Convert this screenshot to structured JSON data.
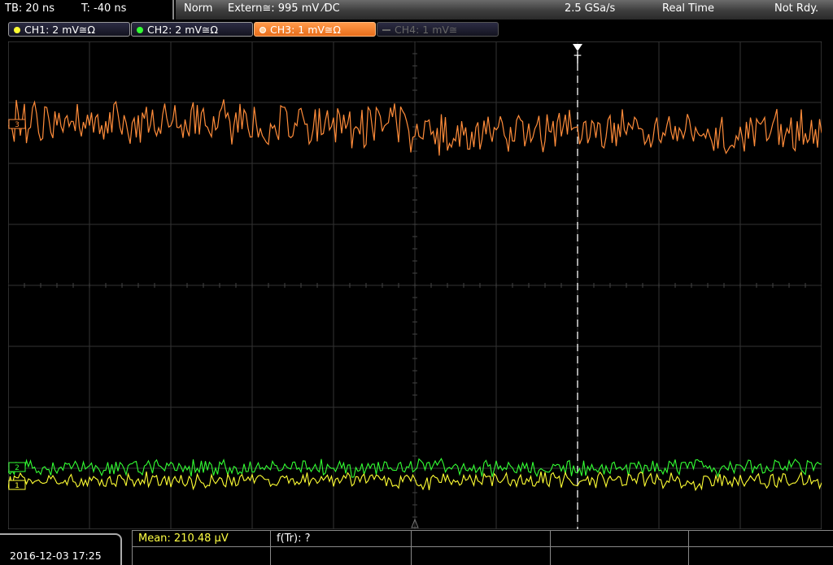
{
  "status": {
    "timebase": "TB: 20 ns",
    "trigger_time": "T: -40 ns",
    "mode": "Norm",
    "trigger_source": "Extern≅: 995 mV ⁄DC",
    "sample_rate": "2.5 GSa/s",
    "acq_mode": "Real Time",
    "state": "Not Rdy."
  },
  "channels": [
    {
      "label": "CH1: 2 mV≅Ω",
      "color": "#ffff33",
      "active": false,
      "enabled": true
    },
    {
      "label": "CH2: 2 mV≅Ω",
      "color": "#33ff33",
      "active": false,
      "enabled": true
    },
    {
      "label": "CH3: 1 mV≅Ω",
      "color": "#ff8c3a",
      "active": true,
      "enabled": true
    },
    {
      "label": "CH4: 1 mV≅",
      "color": "#666666",
      "active": false,
      "enabled": false
    }
  ],
  "trigger_marker": "T",
  "markers": {
    "ch3": "3",
    "ch1": "1",
    "ch2": "2"
  },
  "measurements": {
    "mean": "Mean: 210.48 µV",
    "ftr": "f(Tr): ?"
  },
  "datetime": "2016-12-03 17:25",
  "colors": {
    "ch1": "#ffff33",
    "ch2": "#33ff33",
    "ch3": "#ff8c3a",
    "grid": "#3a3a3a"
  }
}
